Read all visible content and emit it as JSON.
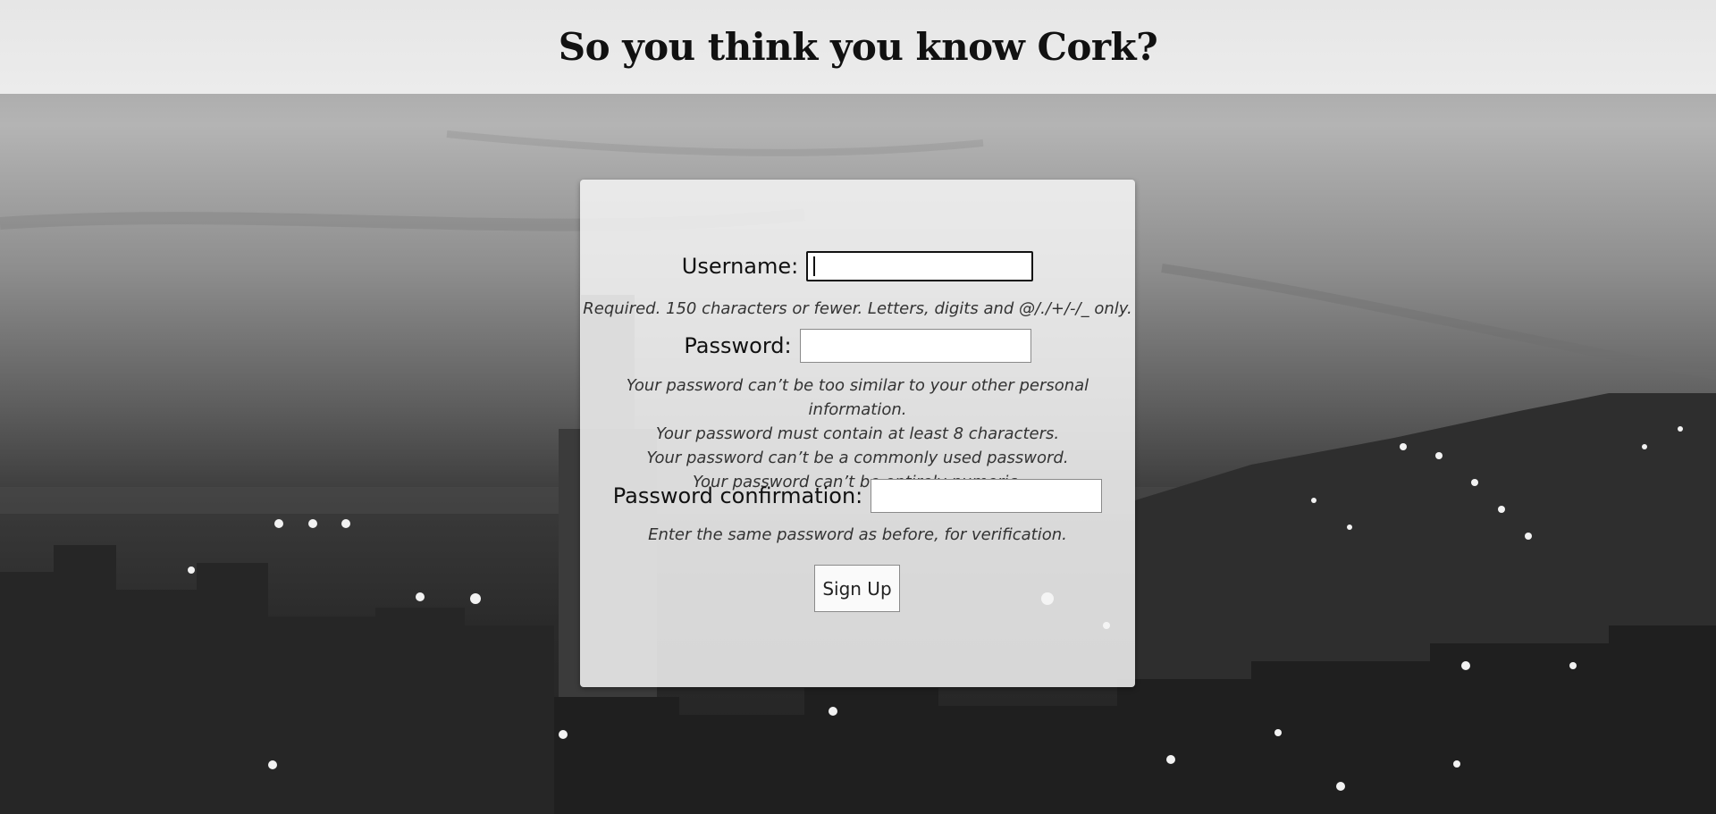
{
  "header": {
    "title": "So you think you know Cork?"
  },
  "form": {
    "username_label": "Username:",
    "username_value": "",
    "username_help": "Required. 150 characters or fewer. Letters, digits and @/./+/-/_ only.",
    "password_label": "Password:",
    "password_value": "",
    "password_help": [
      "Your password can’t be too similar to your other personal information.",
      "Your password must contain at least 8 characters.",
      "Your password can’t be a commonly used password.",
      "Your password can’t be entirely numeric."
    ],
    "password_confirm_label": "Password confirmation:",
    "password_confirm_value": "",
    "password_confirm_help": "Enter the same password as before, for verification.",
    "submit_label": "Sign Up"
  }
}
